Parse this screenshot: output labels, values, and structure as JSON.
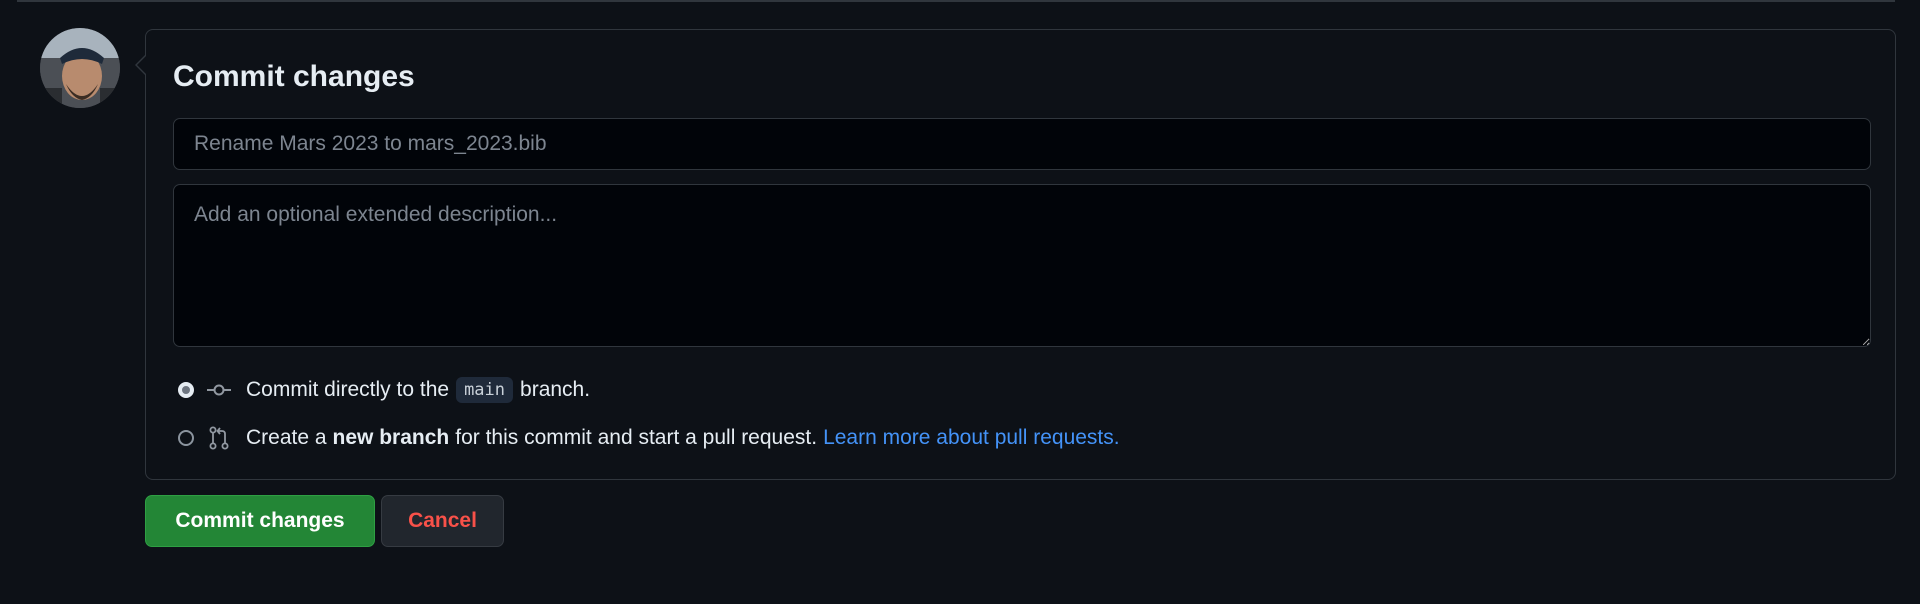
{
  "form": {
    "title": "Commit changes",
    "summary_placeholder": "Rename Mars 2023 to mars_2023.bib",
    "description_placeholder": "Add an optional extended description..."
  },
  "options": {
    "direct": {
      "prefix": "Commit directly to the",
      "branch": "main",
      "suffix": "branch.",
      "selected": true,
      "icon": "git-commit-icon"
    },
    "new_branch": {
      "prefix": "Create a",
      "bold": "new branch",
      "suffix": "for this commit and start a pull request.",
      "link": "Learn more about pull requests.",
      "selected": false,
      "icon": "git-pull-request-icon"
    }
  },
  "buttons": {
    "commit": "Commit changes",
    "cancel": "Cancel"
  },
  "colors": {
    "background": "#0d1117",
    "accent_green": "#238636",
    "danger_red": "#f85149",
    "link_blue": "#4493f8"
  }
}
